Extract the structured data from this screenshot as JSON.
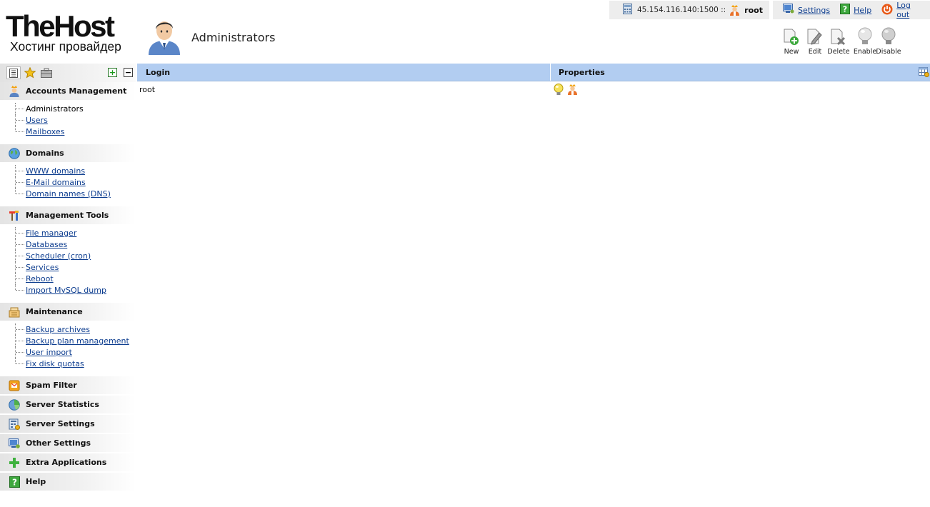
{
  "logo": {
    "main": "TheHost",
    "sub": "Хостинг провайдер"
  },
  "page": {
    "title": "Administrators",
    "icon": "admin-user-icon"
  },
  "server": {
    "address": "45.154.116.140:1500 ::",
    "user": "root"
  },
  "top_links": [
    {
      "label": "Settings",
      "icon": "monitor-settings-icon"
    },
    {
      "label": "Help",
      "icon": "help-icon"
    },
    {
      "label": "Log out",
      "icon": "power-icon"
    }
  ],
  "toolbar": {
    "new": "New",
    "edit": "Edit",
    "delete": "Delete",
    "enable": "Enable",
    "disable": "Disable"
  },
  "sidebar": {
    "tool_icons": [
      "tree-view-icon",
      "favorites-star-icon",
      "briefcase-icon"
    ],
    "sections": [
      {
        "label": "Accounts Management",
        "icon": "accounts-icon",
        "items": [
          "Administrators",
          "Users",
          "Mailboxes"
        ],
        "current": "Administrators"
      },
      {
        "label": "Domains",
        "icon": "globe-icon",
        "items": [
          "WWW domains",
          "E-Mail domains",
          "Domain names (DNS)"
        ]
      },
      {
        "label": "Management Tools",
        "icon": "tools-icon",
        "items": [
          "File manager",
          "Databases",
          "Scheduler (cron)",
          "Services",
          "Reboot",
          "Import MySQL dump"
        ]
      },
      {
        "label": "Maintenance",
        "icon": "maintenance-icon",
        "items": [
          "Backup archives",
          "Backup plan management",
          "User import",
          "Fix disk quotas"
        ]
      },
      {
        "label": "Spam Filter",
        "icon": "spam-filter-icon",
        "items": []
      },
      {
        "label": "Server Statistics",
        "icon": "statistics-icon",
        "items": []
      },
      {
        "label": "Server Settings",
        "icon": "server-settings-icon",
        "items": []
      },
      {
        "label": "Other Settings",
        "icon": "other-settings-icon",
        "items": []
      },
      {
        "label": "Extra Applications",
        "icon": "plus-icon",
        "items": []
      },
      {
        "label": "Help",
        "icon": "help-icon",
        "items": []
      }
    ]
  },
  "table": {
    "columns": [
      "Login",
      "Properties"
    ],
    "rows": [
      {
        "login": "root",
        "properties": [
          "enabled-bulb-icon",
          "superuser-icon"
        ]
      }
    ]
  },
  "colors": {
    "header_blue": "#b2cdf1",
    "link": "#0d3d8f"
  }
}
